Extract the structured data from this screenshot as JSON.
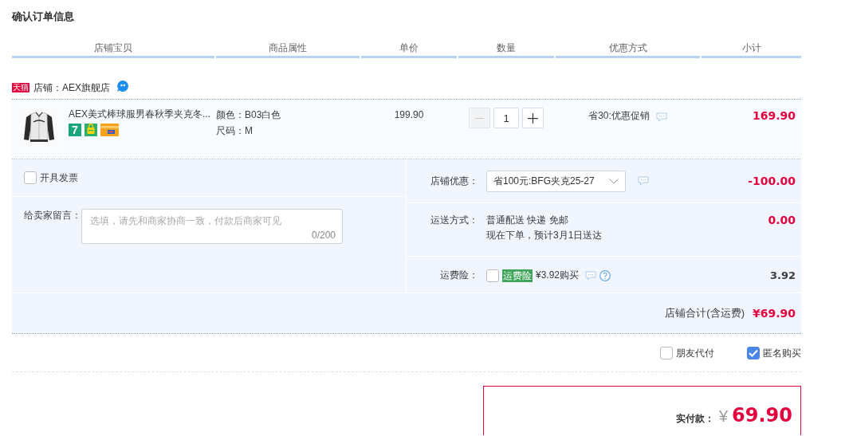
{
  "page": {
    "title": "确认订单信息"
  },
  "table": {
    "columns": [
      "店铺宝贝",
      "商品属性",
      "单价",
      "数量",
      "优惠方式",
      "小计"
    ]
  },
  "shop": {
    "badge": "天猫",
    "label": "店铺：AEX旗舰店"
  },
  "items": [
    {
      "title": "AEX美式棒球服男春秋季夹克冬...",
      "service_badges": [
        {
          "kind": "days",
          "label": "7"
        },
        {
          "kind": "bag"
        },
        {
          "kind": "card"
        }
      ],
      "attributes": [
        "颜色：B03白色",
        "尺码：M"
      ],
      "price": "199.90",
      "quantity": "1",
      "decrease_disabled": true,
      "promotion": "省30:优惠促销",
      "subtotal": "169.90"
    }
  ],
  "invoice": {
    "label": "开具发票",
    "checked": false
  },
  "message": {
    "label": "给卖家留言：",
    "placeholder": "选填，请先和商家协商一致，付款后商家可见",
    "counter": "0/200"
  },
  "shop_discount": {
    "label": "店铺优惠：",
    "value": "省100元:BFG夹克25-27",
    "amount": "-100.00"
  },
  "shipping": {
    "label": "运送方式：",
    "lines": [
      "普通配送 快递 免邮",
      "现在下单，预计3月1日送达"
    ],
    "amount": "0.00"
  },
  "insurance": {
    "label": "运费险：",
    "checked": false,
    "tag": "运费险",
    "price": "¥3.92购买",
    "amount": "3.92"
  },
  "shop_total": {
    "label": "店铺合计(含运费)",
    "amount": "¥69.90"
  },
  "options": [
    {
      "label": "朋友代付",
      "checked": false
    },
    {
      "label": "匿名购买",
      "checked": true
    }
  ],
  "payment": {
    "label": "实付款：",
    "currency": "¥",
    "amount": "69.90"
  }
}
